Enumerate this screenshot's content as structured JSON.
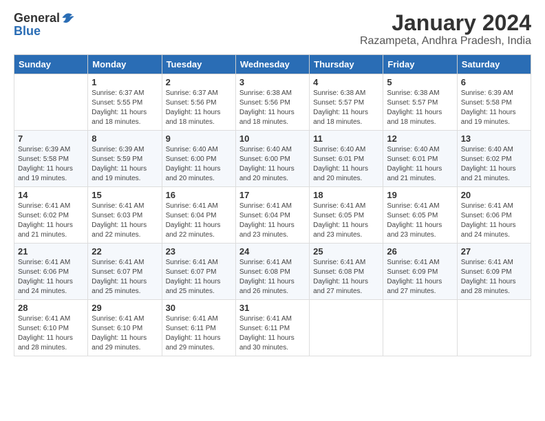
{
  "header": {
    "logo_general": "General",
    "logo_blue": "Blue",
    "title": "January 2024",
    "subtitle": "Razampeta, Andhra Pradesh, India"
  },
  "columns": [
    "Sunday",
    "Monday",
    "Tuesday",
    "Wednesday",
    "Thursday",
    "Friday",
    "Saturday"
  ],
  "weeks": [
    [
      {
        "day": "",
        "sunrise": "",
        "sunset": "",
        "daylight": ""
      },
      {
        "day": "1",
        "sunrise": "Sunrise: 6:37 AM",
        "sunset": "Sunset: 5:55 PM",
        "daylight": "Daylight: 11 hours and 18 minutes."
      },
      {
        "day": "2",
        "sunrise": "Sunrise: 6:37 AM",
        "sunset": "Sunset: 5:56 PM",
        "daylight": "Daylight: 11 hours and 18 minutes."
      },
      {
        "day": "3",
        "sunrise": "Sunrise: 6:38 AM",
        "sunset": "Sunset: 5:56 PM",
        "daylight": "Daylight: 11 hours and 18 minutes."
      },
      {
        "day": "4",
        "sunrise": "Sunrise: 6:38 AM",
        "sunset": "Sunset: 5:57 PM",
        "daylight": "Daylight: 11 hours and 18 minutes."
      },
      {
        "day": "5",
        "sunrise": "Sunrise: 6:38 AM",
        "sunset": "Sunset: 5:57 PM",
        "daylight": "Daylight: 11 hours and 18 minutes."
      },
      {
        "day": "6",
        "sunrise": "Sunrise: 6:39 AM",
        "sunset": "Sunset: 5:58 PM",
        "daylight": "Daylight: 11 hours and 19 minutes."
      }
    ],
    [
      {
        "day": "7",
        "sunrise": "Sunrise: 6:39 AM",
        "sunset": "Sunset: 5:58 PM",
        "daylight": "Daylight: 11 hours and 19 minutes."
      },
      {
        "day": "8",
        "sunrise": "Sunrise: 6:39 AM",
        "sunset": "Sunset: 5:59 PM",
        "daylight": "Daylight: 11 hours and 19 minutes."
      },
      {
        "day": "9",
        "sunrise": "Sunrise: 6:40 AM",
        "sunset": "Sunset: 6:00 PM",
        "daylight": "Daylight: 11 hours and 20 minutes."
      },
      {
        "day": "10",
        "sunrise": "Sunrise: 6:40 AM",
        "sunset": "Sunset: 6:00 PM",
        "daylight": "Daylight: 11 hours and 20 minutes."
      },
      {
        "day": "11",
        "sunrise": "Sunrise: 6:40 AM",
        "sunset": "Sunset: 6:01 PM",
        "daylight": "Daylight: 11 hours and 20 minutes."
      },
      {
        "day": "12",
        "sunrise": "Sunrise: 6:40 AM",
        "sunset": "Sunset: 6:01 PM",
        "daylight": "Daylight: 11 hours and 21 minutes."
      },
      {
        "day": "13",
        "sunrise": "Sunrise: 6:40 AM",
        "sunset": "Sunset: 6:02 PM",
        "daylight": "Daylight: 11 hours and 21 minutes."
      }
    ],
    [
      {
        "day": "14",
        "sunrise": "Sunrise: 6:41 AM",
        "sunset": "Sunset: 6:02 PM",
        "daylight": "Daylight: 11 hours and 21 minutes."
      },
      {
        "day": "15",
        "sunrise": "Sunrise: 6:41 AM",
        "sunset": "Sunset: 6:03 PM",
        "daylight": "Daylight: 11 hours and 22 minutes."
      },
      {
        "day": "16",
        "sunrise": "Sunrise: 6:41 AM",
        "sunset": "Sunset: 6:04 PM",
        "daylight": "Daylight: 11 hours and 22 minutes."
      },
      {
        "day": "17",
        "sunrise": "Sunrise: 6:41 AM",
        "sunset": "Sunset: 6:04 PM",
        "daylight": "Daylight: 11 hours and 23 minutes."
      },
      {
        "day": "18",
        "sunrise": "Sunrise: 6:41 AM",
        "sunset": "Sunset: 6:05 PM",
        "daylight": "Daylight: 11 hours and 23 minutes."
      },
      {
        "day": "19",
        "sunrise": "Sunrise: 6:41 AM",
        "sunset": "Sunset: 6:05 PM",
        "daylight": "Daylight: 11 hours and 23 minutes."
      },
      {
        "day": "20",
        "sunrise": "Sunrise: 6:41 AM",
        "sunset": "Sunset: 6:06 PM",
        "daylight": "Daylight: 11 hours and 24 minutes."
      }
    ],
    [
      {
        "day": "21",
        "sunrise": "Sunrise: 6:41 AM",
        "sunset": "Sunset: 6:06 PM",
        "daylight": "Daylight: 11 hours and 24 minutes."
      },
      {
        "day": "22",
        "sunrise": "Sunrise: 6:41 AM",
        "sunset": "Sunset: 6:07 PM",
        "daylight": "Daylight: 11 hours and 25 minutes."
      },
      {
        "day": "23",
        "sunrise": "Sunrise: 6:41 AM",
        "sunset": "Sunset: 6:07 PM",
        "daylight": "Daylight: 11 hours and 25 minutes."
      },
      {
        "day": "24",
        "sunrise": "Sunrise: 6:41 AM",
        "sunset": "Sunset: 6:08 PM",
        "daylight": "Daylight: 11 hours and 26 minutes."
      },
      {
        "day": "25",
        "sunrise": "Sunrise: 6:41 AM",
        "sunset": "Sunset: 6:08 PM",
        "daylight": "Daylight: 11 hours and 27 minutes."
      },
      {
        "day": "26",
        "sunrise": "Sunrise: 6:41 AM",
        "sunset": "Sunset: 6:09 PM",
        "daylight": "Daylight: 11 hours and 27 minutes."
      },
      {
        "day": "27",
        "sunrise": "Sunrise: 6:41 AM",
        "sunset": "Sunset: 6:09 PM",
        "daylight": "Daylight: 11 hours and 28 minutes."
      }
    ],
    [
      {
        "day": "28",
        "sunrise": "Sunrise: 6:41 AM",
        "sunset": "Sunset: 6:10 PM",
        "daylight": "Daylight: 11 hours and 28 minutes."
      },
      {
        "day": "29",
        "sunrise": "Sunrise: 6:41 AM",
        "sunset": "Sunset: 6:10 PM",
        "daylight": "Daylight: 11 hours and 29 minutes."
      },
      {
        "day": "30",
        "sunrise": "Sunrise: 6:41 AM",
        "sunset": "Sunset: 6:11 PM",
        "daylight": "Daylight: 11 hours and 29 minutes."
      },
      {
        "day": "31",
        "sunrise": "Sunrise: 6:41 AM",
        "sunset": "Sunset: 6:11 PM",
        "daylight": "Daylight: 11 hours and 30 minutes."
      },
      {
        "day": "",
        "sunrise": "",
        "sunset": "",
        "daylight": ""
      },
      {
        "day": "",
        "sunrise": "",
        "sunset": "",
        "daylight": ""
      },
      {
        "day": "",
        "sunrise": "",
        "sunset": "",
        "daylight": ""
      }
    ]
  ]
}
